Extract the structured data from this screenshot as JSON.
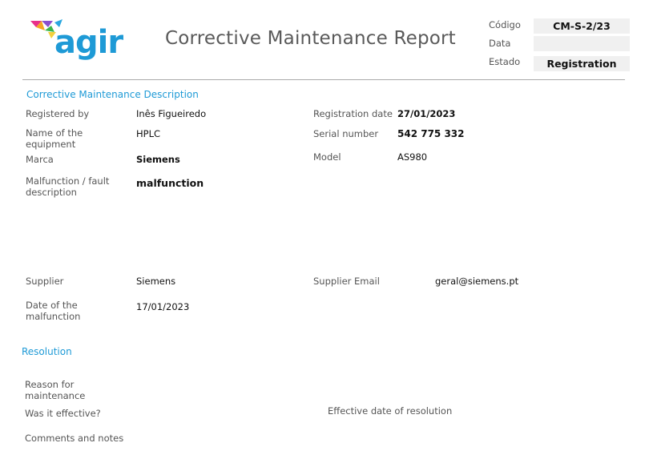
{
  "logo": {
    "text": "agir"
  },
  "header": {
    "title": "Corrective Maintenance Report",
    "meta": [
      {
        "label": "Código",
        "value": "CM-S-2/23"
      },
      {
        "label": "Data",
        "value": ""
      },
      {
        "label": "Estado",
        "value": "Registration"
      }
    ]
  },
  "description": {
    "heading": "Corrective Maintenance Description",
    "registered_by": {
      "label": "Registered by",
      "value": "Inês Figueiredo"
    },
    "equipment_name": {
      "label": "Name of the equipment",
      "value": "HPLC"
    },
    "marca": {
      "label": "Marca",
      "value": "Siemens"
    },
    "fault": {
      "label": "Malfunction / fault description",
      "value": "malfunction"
    },
    "registration_date": {
      "label": "Registration date",
      "value": "27/01/2023"
    },
    "serial_number": {
      "label": "Serial number",
      "value": "542 775 332"
    },
    "model": {
      "label": "Model",
      "value": "AS980"
    },
    "supplier": {
      "label": "Supplier",
      "value": "Siemens"
    },
    "supplier_email": {
      "label": "Supplier Email",
      "value": "geral@siemens.pt"
    },
    "malfunction_date": {
      "label": "Date of the malfunction",
      "value": "17/01/2023"
    }
  },
  "resolution": {
    "heading": "Resolution",
    "reason_label": "Reason for maintenance",
    "effective_label": "Was it effective?",
    "effective_date_label": "Effective date of resolution",
    "comments_label": "Comments and notes"
  }
}
